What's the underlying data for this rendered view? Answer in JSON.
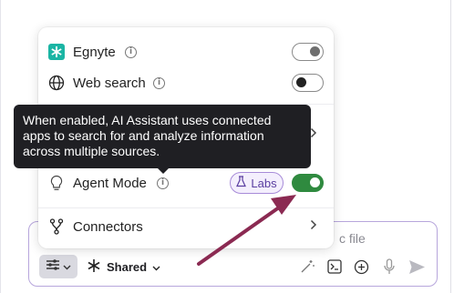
{
  "menu": {
    "egnyte": {
      "label": "Egnyte",
      "icon": "egnyte-logo-icon",
      "enabled": false
    },
    "web_search": {
      "label": "Web search",
      "icon": "globe-icon",
      "enabled": false
    },
    "agent_mode": {
      "label": "Agent Mode",
      "icon": "lightbulb-icon",
      "badge": "Labs",
      "enabled": true
    },
    "connectors": {
      "label": "Connectors",
      "icon": "connectors-icon"
    }
  },
  "tooltip": {
    "text": "When enabled, AI Assistant uses connected apps to search for and analyze information across multiple sources."
  },
  "composer": {
    "placeholder_fragment": "c file",
    "shared_label": "Shared"
  },
  "colors": {
    "accent": "#2f8a3f",
    "labs_border": "#a78bd8",
    "annotation_arrow": "#8b2a52",
    "tooltip_bg": "#1f1f23"
  }
}
